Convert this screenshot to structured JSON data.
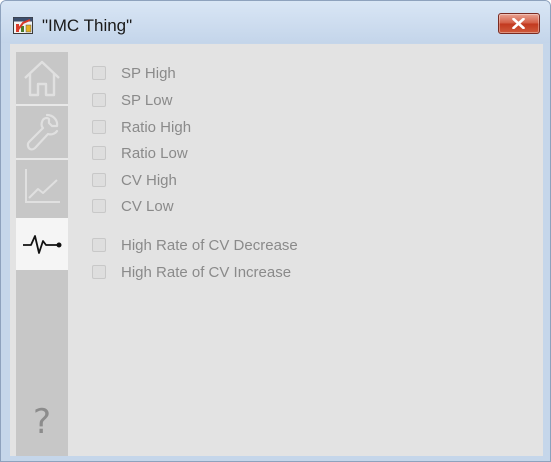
{
  "window": {
    "title": "\"IMC Thing\"",
    "close_icon": "close-x-icon"
  },
  "sidebar": {
    "items": [
      {
        "id": "home",
        "icon": "home-icon",
        "active": false
      },
      {
        "id": "maintenance",
        "icon": "wrench-icon",
        "active": false
      },
      {
        "id": "trends",
        "icon": "trend-icon",
        "active": false
      },
      {
        "id": "alarms",
        "icon": "alarm-pulse-icon",
        "active": true
      }
    ],
    "help_label": "?"
  },
  "alarms": {
    "group1": [
      {
        "label": "SP High",
        "checked": false
      },
      {
        "label": "SP Low",
        "checked": false
      },
      {
        "label": "Ratio High",
        "checked": false
      },
      {
        "label": "Ratio Low",
        "checked": false
      },
      {
        "label": "CV High",
        "checked": false
      },
      {
        "label": "CV Low",
        "checked": false
      }
    ],
    "group2": [
      {
        "label": "High Rate of CV Decrease",
        "checked": false
      },
      {
        "label": "High Rate of CV Increase",
        "checked": false
      }
    ]
  },
  "colors": {
    "sidebar_bg": "#c7c7c7",
    "active_tab_bg": "#f5f5f5",
    "content_bg": "#e3e3e3",
    "label_text": "#8a8a8a",
    "close_button": "#c7412a"
  }
}
